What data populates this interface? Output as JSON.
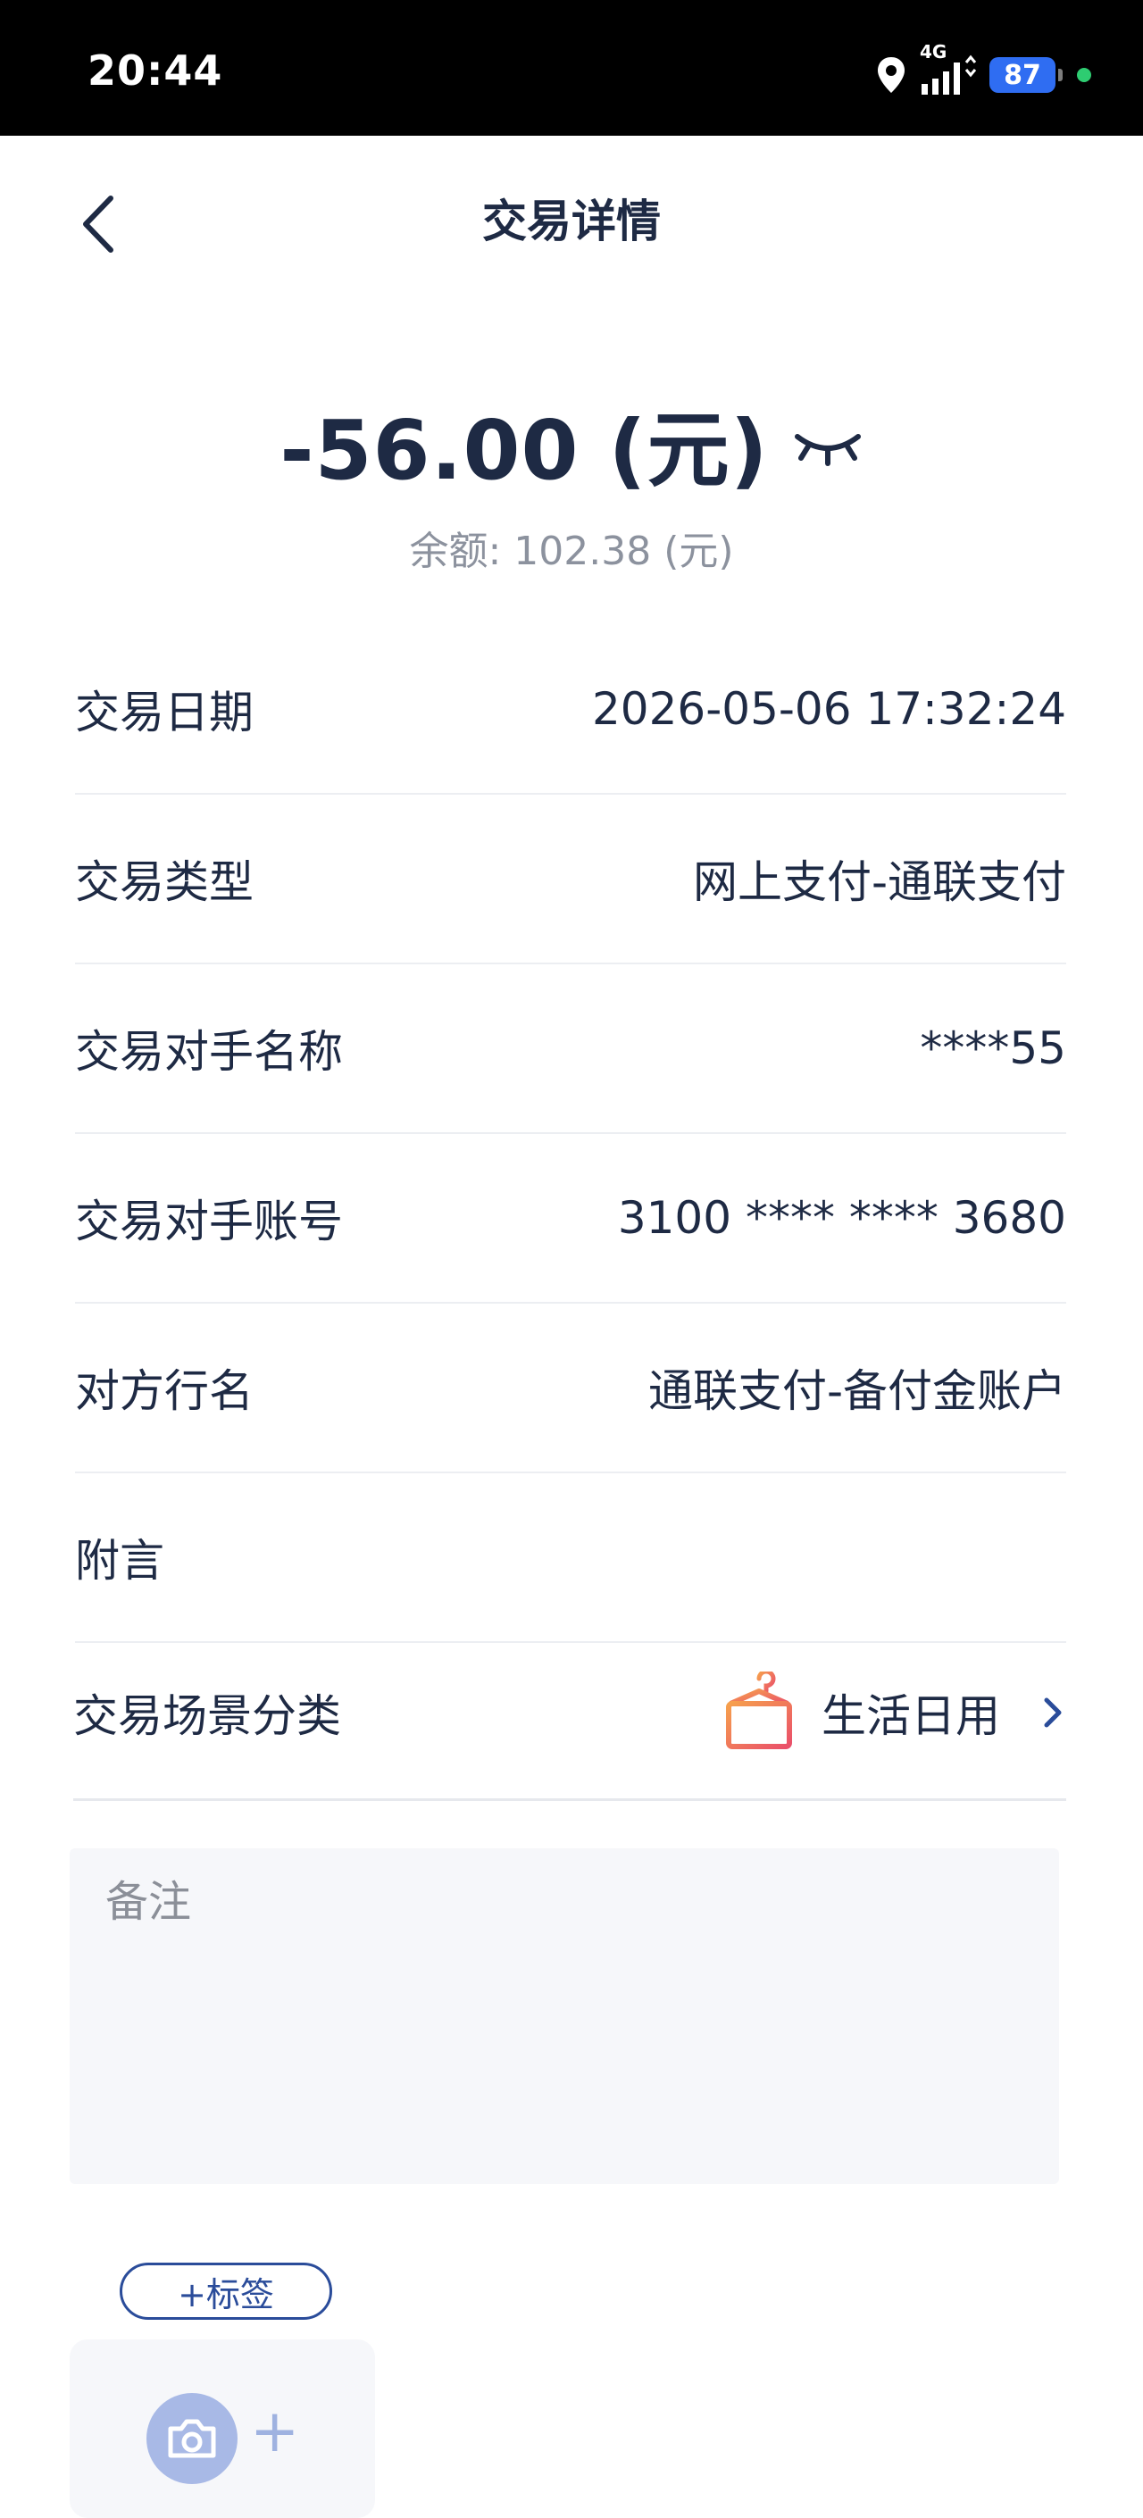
{
  "status_bar": {
    "time": "20:44",
    "network": "4G",
    "battery": "87",
    "icons": [
      "location-icon",
      "signal-icon",
      "battery-icon",
      "active-dot-icon"
    ]
  },
  "header": {
    "title": "交易详情",
    "back_icon": "chevron-left-icon"
  },
  "summary": {
    "amount": "-56.00 (元)",
    "balance": "余额: 102.38 (元)",
    "eye_icon": "eye-closed-icon"
  },
  "details": [
    {
      "label": "交易日期",
      "value": "2026-05-06 17:32:24"
    },
    {
      "label": "交易类型",
      "value": "网上支付-通联支付"
    },
    {
      "label": "交易对手名称",
      "value": "****55"
    },
    {
      "label": "交易对手账号",
      "value": "3100 **** **** 3680"
    },
    {
      "label": "对方行名",
      "value": "通联支付-备付金账户"
    },
    {
      "label": "附言",
      "value": ""
    }
  ],
  "scene": {
    "label": "交易场景分类",
    "category": "生活日用",
    "icon": "hanger-icon",
    "chevron": "chevron-right-icon"
  },
  "note": {
    "placeholder": "备注"
  },
  "tag_button": {
    "label": "+标签"
  },
  "photo": {
    "camera_icon": "camera-icon",
    "plus_icon": "plus-icon"
  },
  "colors": {
    "status_bg": "#000000",
    "battery": "#2f6df2",
    "text_primary": "#1e2a44",
    "text_muted": "#8c929e",
    "tag_border": "#2a4c9a",
    "input_bg": "#f6f7fa"
  }
}
